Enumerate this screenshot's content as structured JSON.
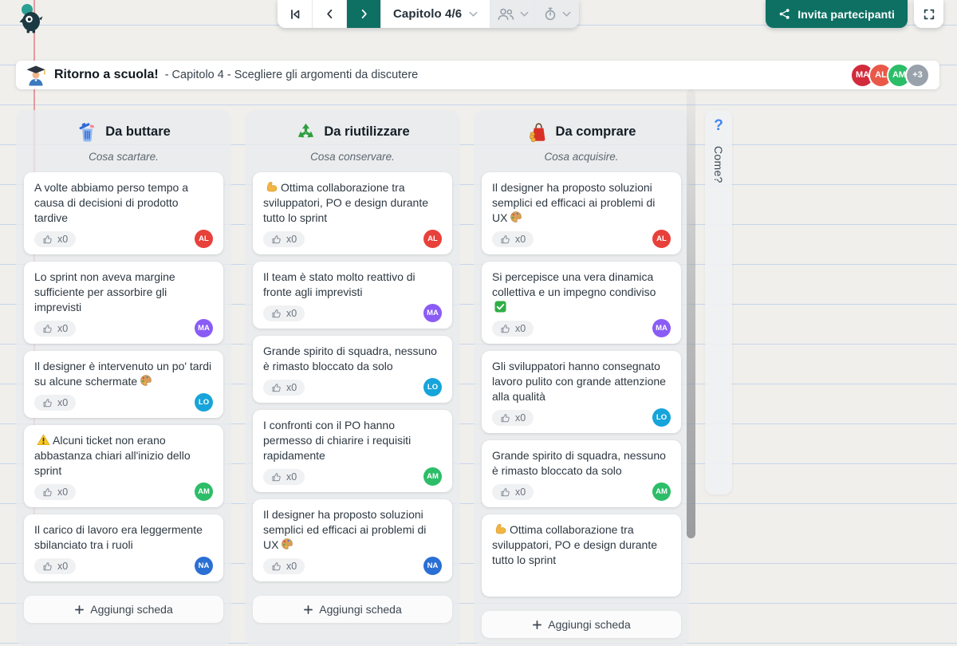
{
  "colors": {
    "accent_teal": "#0d7063",
    "paper_line_blue": "#c5d5ea",
    "margin_line_red": "#e2545f"
  },
  "topbar": {
    "logo_icon": "mascot-logo",
    "skip_start_icon": "skip-start-icon",
    "prev_icon": "chevron-left-icon",
    "next_icon": "chevron-right-icon",
    "chapter_selector": {
      "label": "Capitolo 4/6",
      "chevron": "chevron-down-icon"
    },
    "participants_button": {
      "icon": "people-icon",
      "state": "disabled"
    },
    "timer_button": {
      "icon": "stopwatch-icon",
      "state": "disabled"
    },
    "invite_button": {
      "label": "Invita partecipanti",
      "icon": "share-icon"
    },
    "fullscreen_icon": "fullscreen-icon"
  },
  "header": {
    "icon": "student-icon",
    "title": "Ritorno a scuola!",
    "subtitle": "- Capitolo 4 - Scegliere gli argomenti da discutere",
    "avatars": [
      {
        "initials": "MA",
        "color": "#d22b3c"
      },
      {
        "initials": "AL",
        "color": "#ea5948"
      },
      {
        "initials": "AM",
        "color": "#2cbd68"
      },
      {
        "initials": "+3",
        "color": "#99a2aa"
      }
    ]
  },
  "board": {
    "columns": [
      {
        "icon": "trash-icon",
        "title": "Da buttare",
        "subtitle": "Cosa scartare.",
        "add_card_label": "Aggiungi scheda",
        "cards": [
          {
            "text": "A volte abbiamo perso tempo a causa di decisioni di prodotto tardive",
            "likes": "x0",
            "author": {
              "initials": "AL",
              "color": "#e8403a"
            }
          },
          {
            "text": "Lo sprint non aveva margine sufficiente per assorbire gli imprevisti",
            "likes": "x0",
            "author": {
              "initials": "MA",
              "color": "#8a5cf5"
            }
          },
          {
            "text": "Il designer è intervenuto un po' tardi su alcune schermate",
            "suffix_icon": "palette-icon",
            "likes": "x0",
            "author": {
              "initials": "LO",
              "color": "#16a4da"
            }
          },
          {
            "prefix_icon": "warning-icon",
            "text": "Alcuni ticket non erano abbastanza chiari all'inizio dello sprint",
            "likes": "x0",
            "author": {
              "initials": "AM",
              "color": "#2cbd68"
            }
          },
          {
            "text": "Il carico di lavoro era leggermente sbilanciato tra i ruoli",
            "likes": "x0",
            "author": {
              "initials": "NA",
              "color": "#2a6fd4"
            }
          }
        ]
      },
      {
        "icon": "recycle-icon",
        "title": "Da riutilizzare",
        "subtitle": "Cosa conservare.",
        "add_card_label": "Aggiungi scheda",
        "cards": [
          {
            "prefix_icon": "muscle-icon",
            "text": "Ottima collaborazione tra sviluppatori, PO e design durante tutto lo sprint",
            "likes": "x0",
            "author": {
              "initials": "AL",
              "color": "#e8403a"
            }
          },
          {
            "text": "Il team è stato molto reattivo di fronte agli imprevisti",
            "likes": "x0",
            "author": {
              "initials": "MA",
              "color": "#8a5cf5"
            }
          },
          {
            "text": "Grande spirito di squadra, nessuno è rimasto bloccato da solo",
            "likes": "x0",
            "author": {
              "initials": "LO",
              "color": "#16a4da"
            }
          },
          {
            "text": "I confronti con il PO hanno permesso di chiarire i requisiti rapidamente",
            "likes": "x0",
            "author": {
              "initials": "AM",
              "color": "#2cbd68"
            }
          },
          {
            "text": "Il designer ha proposto soluzioni semplici ed efficaci ai problemi di UX",
            "suffix_icon": "palette-icon",
            "likes": "x0",
            "author": {
              "initials": "NA",
              "color": "#2a6fd4"
            }
          }
        ]
      },
      {
        "icon": "shopping-icon",
        "title": "Da comprare",
        "subtitle": "Cosa acquisire.",
        "add_card_label": "Aggiungi scheda",
        "cards": [
          {
            "text": "Il designer ha proposto soluzioni semplici ed efficaci ai problemi di UX",
            "suffix_icon": "palette-icon",
            "likes": "x0",
            "author": {
              "initials": "AL",
              "color": "#e8403a"
            }
          },
          {
            "text": "Si percepisce una vera dinamica collettiva e un impegno condiviso",
            "suffix_icon": "check-icon",
            "likes": "x0",
            "author": {
              "initials": "MA",
              "color": "#8a5cf5"
            }
          },
          {
            "text": "Gli sviluppatori hanno consegnato lavoro pulito con grande attenzione alla qualità",
            "likes": "x0",
            "author": {
              "initials": "LO",
              "color": "#16a4da"
            }
          },
          {
            "text": "Grande spirito di squadra, nessuno è rimasto bloccato da solo",
            "likes": "x0",
            "author": {
              "initials": "AM",
              "color": "#2cbd68"
            }
          },
          {
            "prefix_icon": "muscle-icon",
            "text": "Ottima collaborazione tra sviluppatori, PO e design durante tutto lo sprint",
            "likes": null,
            "author": null
          }
        ]
      }
    ]
  },
  "help_panel": {
    "icon": "question-icon",
    "label": "Come?"
  }
}
